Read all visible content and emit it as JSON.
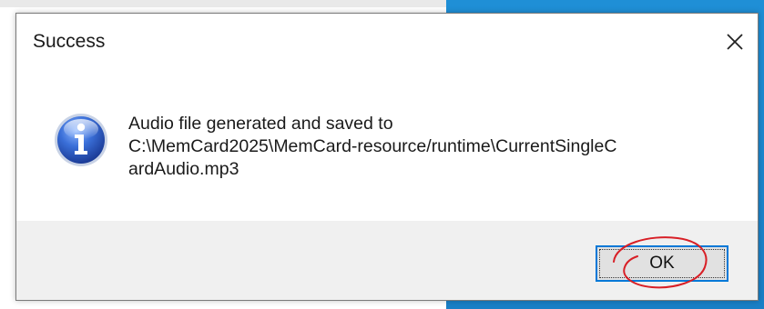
{
  "window": {
    "title": "Success",
    "close_icon": "close-icon"
  },
  "message": {
    "icon": "info-icon",
    "line1": "Audio file generated and saved to",
    "line2": "C:\\MemCard2025\\MemCard-resource/runtime\\CurrentSingleC",
    "line3": "ardAudio.mp3"
  },
  "buttons": {
    "ok_label": "OK"
  },
  "colors": {
    "desktop_blue": "#1f8fd6",
    "button_focus_border": "#0078d7",
    "footer_bg": "#f0f0f0",
    "annotation_red": "#d81f26"
  }
}
